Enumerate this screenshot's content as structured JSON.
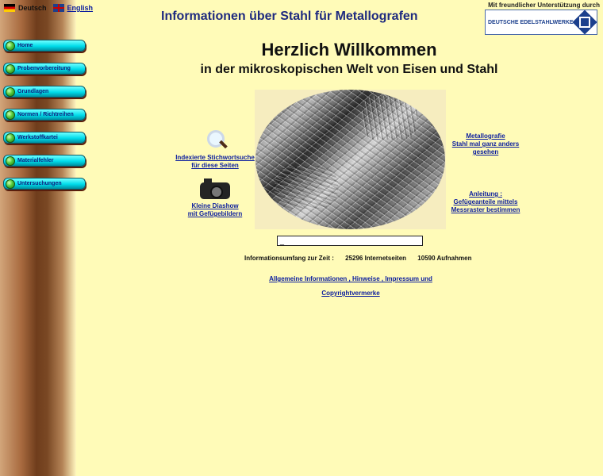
{
  "header": {
    "language_de": "Deutsch",
    "language_en": "English",
    "title": "Informationen über Stahl für Metallografen",
    "sponsor_text": "Mit freundlicher Unterstützung durch",
    "sponsor_logo_text": "DEUTSCHE EDELSTAHLWERKE"
  },
  "sidebar": {
    "items": [
      {
        "label": "Home"
      },
      {
        "label": "Probenvorbereitung"
      },
      {
        "label": "Grundlagen"
      },
      {
        "label": "Normen / Richtreihen"
      },
      {
        "label": "Werkstoffkartei"
      },
      {
        "label": "Materialfehler"
      },
      {
        "label": "Untersuchungen"
      }
    ]
  },
  "main": {
    "welcome_title": "Herzlich Willkommen",
    "welcome_subtitle": "in der mikroskopischen Welt von Eisen und Stahl",
    "search_link_1": "Indexierte Stichwortsuche",
    "search_link_2": "für diese Seiten",
    "slideshow_link_1": "Kleine Diashow",
    "slideshow_link_2": "mit Gefügebildern",
    "right_link_1a": "Metallografie",
    "right_link_1b": "Stahl mal ganz anders",
    "right_link_1c": "gesehen",
    "right_link_2a": "Anleitung :",
    "right_link_2b": "Gefügeanteile mittels",
    "right_link_2c": "Messraster bestimmen",
    "search_value": "_",
    "stats_label": "Informationsumfang zur Zeit :",
    "stats_pages": "25296 Internetseiten",
    "stats_images": "10590 Aufnahmen",
    "footer_link": "Allgemeine Informationen , Hinweise , Impressum und Copyrightvermerke"
  },
  "colors": {
    "background": "#fffbb8",
    "title": "#1e2a7f",
    "link": "#0b1d9e",
    "nav_button": "#00dcea"
  },
  "icons": {
    "flag_de": "german-flag-icon",
    "flag_en": "english-flag-icon",
    "search": "magnifier-icon",
    "slideshow": "camera-icon"
  }
}
